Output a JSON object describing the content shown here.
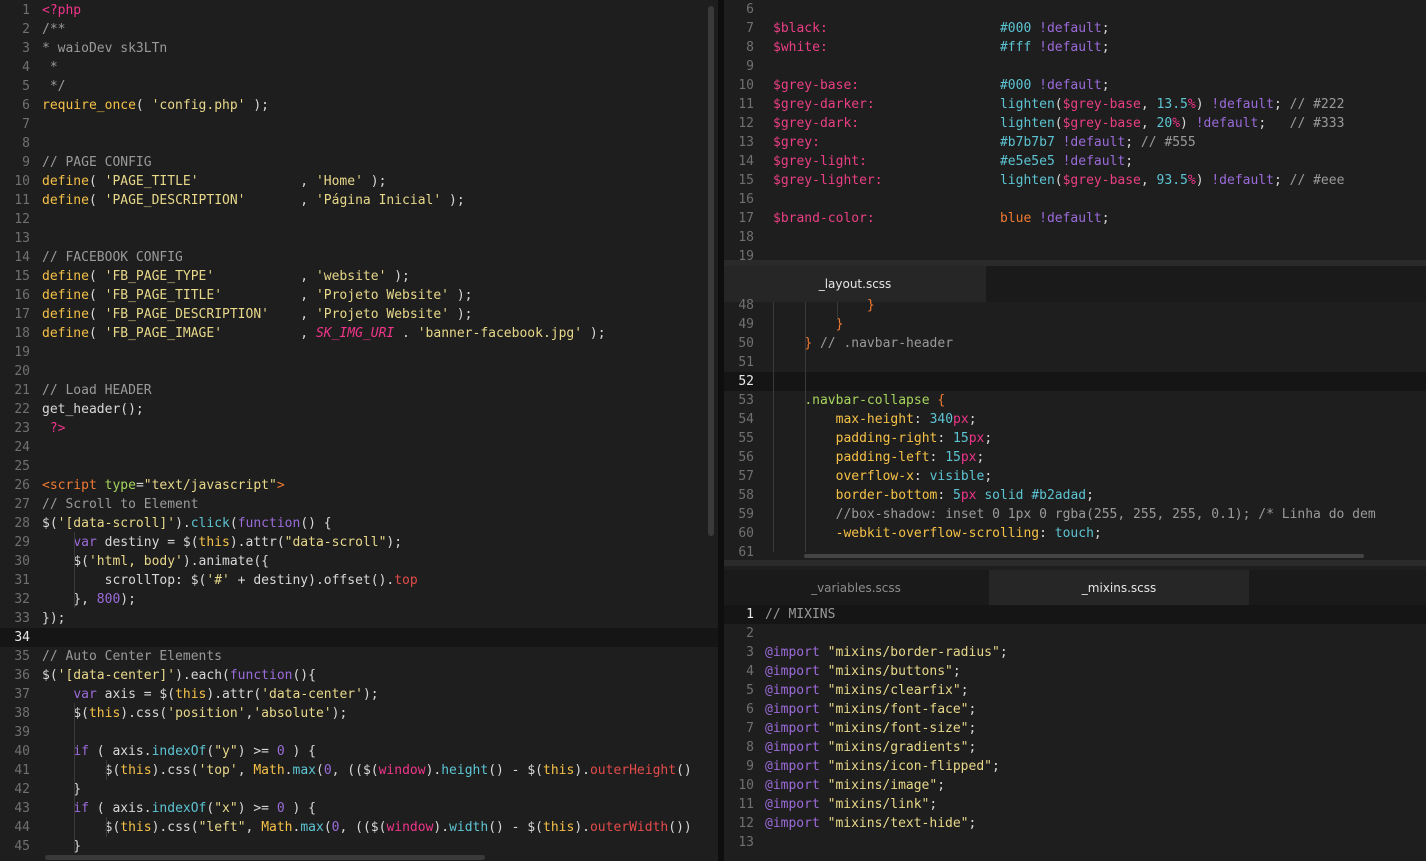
{
  "left_editor": {
    "lines": [
      {
        "n": "1",
        "html": "<span class='pink'>&lt;?php</span>"
      },
      {
        "n": "2",
        "html": "<span class='c'>/**</span>"
      },
      {
        "n": "3",
        "html": "<span class='c'>* waioDev sk3LTn</span>"
      },
      {
        "n": "4",
        "html": "<span class='c'> *</span>"
      },
      {
        "n": "5",
        "html": "<span class='c'> */</span>"
      },
      {
        "n": "6",
        "html": "<span class='y'>require_once</span>( <span class='s'>'config.php'</span> );"
      },
      {
        "n": "7",
        "html": ""
      },
      {
        "n": "8",
        "html": ""
      },
      {
        "n": "9",
        "html": "<span class='c'>// PAGE CONFIG</span>"
      },
      {
        "n": "10",
        "html": "<span class='y'>define</span>( <span class='s'>'PAGE_TITLE'</span>             , <span class='s'>'Home'</span> );"
      },
      {
        "n": "11",
        "html": "<span class='y'>define</span>( <span class='s'>'PAGE_DESCRIPTION'</span>       , <span class='s'>'Página Inicial'</span> );"
      },
      {
        "n": "12",
        "html": ""
      },
      {
        "n": "13",
        "html": ""
      },
      {
        "n": "14",
        "html": "<span class='c'>// FACEBOOK CONFIG</span>"
      },
      {
        "n": "15",
        "html": "<span class='y'>define</span>( <span class='s'>'FB_PAGE_TYPE'</span>           , <span class='s'>'website'</span> );"
      },
      {
        "n": "16",
        "html": "<span class='y'>define</span>( <span class='s'>'FB_PAGE_TITLE'</span>          , <span class='s'>'Projeto Website'</span> );"
      },
      {
        "n": "17",
        "html": "<span class='y'>define</span>( <span class='s'>'FB_PAGE_DESCRIPTION'</span>    , <span class='s'>'Projeto Website'</span> );"
      },
      {
        "n": "18",
        "html": "<span class='y'>define</span>( <span class='s'>'FB_PAGE_IMAGE'</span>          , <span class='pink'><i>SK_IMG_URI</i></span> . <span class='s'>'banner-facebook.jpg'</span> );"
      },
      {
        "n": "19",
        "html": ""
      },
      {
        "n": "20",
        "html": ""
      },
      {
        "n": "21",
        "html": "<span class='c'>// Load HEADER</span>"
      },
      {
        "n": "22",
        "html": "get_header();"
      },
      {
        "n": "23",
        "html": " <span class='pink'>?&gt;</span>"
      },
      {
        "n": "24",
        "html": ""
      },
      {
        "n": "25",
        "html": ""
      },
      {
        "n": "26",
        "html": "<span class='k'>&lt;script</span> <span class='grn'>type</span>=<span class='s'>\"text/javascript\"</span><span class='k'>&gt;</span>"
      },
      {
        "n": "27",
        "html": "<span class='c'>// Scroll to Element</span>"
      },
      {
        "n": "28",
        "html": "$(<span class='s'>'[data-scroll]'</span>).<span class='cy'>click</span>(<span class='pur'>function</span>() {"
      },
      {
        "n": "29",
        "html": "    <span class='pur'>var</span> destiny = $(<span class='y'>this</span>).attr(<span class='s'>\"data-scroll\"</span>);"
      },
      {
        "n": "30",
        "html": "    $(<span class='s'>'html, body'</span>).animate({"
      },
      {
        "n": "31",
        "html": "        scrollTop: $(<span class='s'>'#'</span> + destiny).offset().<span class='red'>top</span>"
      },
      {
        "n": "32",
        "html": "    }, <span class='pur'>800</span>);"
      },
      {
        "n": "33",
        "html": "});"
      },
      {
        "n": "34",
        "html": "",
        "hl": true
      },
      {
        "n": "35",
        "html": "<span class='c'>// Auto Center Elements</span>"
      },
      {
        "n": "36",
        "html": "$(<span class='s'>'[data-center]'</span>).each(<span class='pur'>function</span>(){"
      },
      {
        "n": "37",
        "html": "    <span class='pur'>var</span> axis = $(<span class='y'>this</span>).attr(<span class='s'>'data-center'</span>);"
      },
      {
        "n": "38",
        "html": "    $(<span class='y'>this</span>).css(<span class='s'>'position'</span>,<span class='s'>'absolute'</span>);"
      },
      {
        "n": "39",
        "html": ""
      },
      {
        "n": "40",
        "html": "    <span class='pur'>if</span> ( axis.<span class='cy'>indexOf</span>(<span class='s'>\"y\"</span>) &gt;= <span class='pur'>0</span> ) {"
      },
      {
        "n": "41",
        "html": "        $(<span class='y'>this</span>).css(<span class='s'>'top'</span>, <span class='y'>Math</span>.<span class='cy'>max</span>(<span class='pur'>0</span>, (($(<span class='pink'>window</span>).<span class='cy'>height</span>() - $(<span class='y'>this</span>).<span class='red'>outerHeight</span>()"
      },
      {
        "n": "42",
        "html": "    }"
      },
      {
        "n": "43",
        "html": "    <span class='pur'>if</span> ( axis.<span class='cy'>indexOf</span>(<span class='s'>\"x\"</span>) &gt;= <span class='pur'>0</span> ) {"
      },
      {
        "n": "44",
        "html": "        $(<span class='y'>this</span>).css(<span class='s'>\"left\"</span>, <span class='y'>Math</span>.<span class='cy'>max</span>(<span class='pur'>0</span>, (($(<span class='pink'>window</span>).<span class='cy'>width</span>() - $(<span class='y'>this</span>).<span class='red'>outerWidth</span>())"
      },
      {
        "n": "45",
        "html": "    }"
      }
    ]
  },
  "top_right_editor": {
    "lines": [
      {
        "n": "6",
        "html": ""
      },
      {
        "n": "7",
        "html": "<span class='var'>$black:</span>                      <span class='cy'>#000</span> <span class='pur'>!default</span>;"
      },
      {
        "n": "8",
        "html": "<span class='var'>$white:</span>                      <span class='cy'>#fff</span> <span class='pur'>!default</span>;"
      },
      {
        "n": "9",
        "html": ""
      },
      {
        "n": "10",
        "html": "<span class='var'>$grey-base:</span>                  <span class='cy'>#000</span> <span class='pur'>!default</span>;"
      },
      {
        "n": "11",
        "html": "<span class='var'>$grey-darker:</span>                <span class='cy'>lighten</span>(<span class='var'>$grey-base</span>, <span class='cy'>13.5</span><span class='pink'>%</span>) <span class='pur'>!default</span>; <span class='c'>// #222</span>"
      },
      {
        "n": "12",
        "html": "<span class='var'>$grey-dark:</span>                  <span class='cy'>lighten</span>(<span class='var'>$grey-base</span>, <span class='cy'>20</span><span class='pink'>%</span>) <span class='pur'>!default</span>;   <span class='c'>// #333</span>"
      },
      {
        "n": "13",
        "html": "<span class='var'>$grey:</span>                       <span class='cy'>#b7b7b7</span> <span class='pur'>!default</span>; <span class='c'>// #555</span>"
      },
      {
        "n": "14",
        "html": "<span class='var'>$grey-light:</span>                 <span class='cy'>#e5e5e5</span> <span class='pur'>!default</span>;"
      },
      {
        "n": "15",
        "html": "<span class='var'>$grey-lighter:</span>               <span class='cy'>lighten</span>(<span class='var'>$grey-base</span>, <span class='cy'>93.5</span><span class='pink'>%</span>) <span class='pur'>!default</span>; <span class='c'>// #eee</span>"
      },
      {
        "n": "16",
        "html": ""
      },
      {
        "n": "17",
        "html": "<span class='var'>$brand-color:</span>                <span class='k'>blue</span> <span class='pur'>!default</span>;"
      },
      {
        "n": "18",
        "html": ""
      },
      {
        "n": "19",
        "html": ""
      }
    ]
  },
  "middle_right_editor": {
    "tab": "_layout.scss",
    "lines": [
      {
        "n": "48",
        "html": "            <span class='k'>}</span>"
      },
      {
        "n": "49",
        "html": "        <span class='k'>}</span>"
      },
      {
        "n": "50",
        "html": "    <span class='k'>}</span> <span class='c'>// .navbar-header</span>"
      },
      {
        "n": "51",
        "html": ""
      },
      {
        "n": "52",
        "html": "",
        "hl": true
      },
      {
        "n": "53",
        "html": "    <span class='grn'>.navbar-collapse</span> <span class='k'>{</span>"
      },
      {
        "n": "54",
        "html": "        <span class='y'>max-height</span>: <span class='cy'>340</span><span class='pink'>px</span>;"
      },
      {
        "n": "55",
        "html": "        <span class='y'>padding-right</span>: <span class='cy'>15</span><span class='pink'>px</span>;"
      },
      {
        "n": "56",
        "html": "        <span class='y'>padding-left</span>: <span class='cy'>15</span><span class='pink'>px</span>;"
      },
      {
        "n": "57",
        "html": "        <span class='y'>overflow-x</span>: <span class='cy'>visible</span>;"
      },
      {
        "n": "58",
        "html": "        <span class='y'>border-bottom</span>: <span class='cy'>5</span><span class='pink'>px</span> <span class='cy'>solid</span> <span class='cy'>#b2adad</span>;"
      },
      {
        "n": "59",
        "html": "        <span class='c'>//box-shadow: inset 0 1px 0 rgba(255, 255, 255, 0.1); /* Linha do dem</span>"
      },
      {
        "n": "60",
        "html": "        <span class='y'>-webkit-overflow-scrolling</span>: <span class='cy'>touch</span>;"
      },
      {
        "n": "61",
        "html": ""
      }
    ]
  },
  "bottom_right_editor": {
    "tabs": [
      "_variables.scss",
      "_mixins.scss"
    ],
    "lines": [
      {
        "n": "1",
        "html": "<span class='c'>// MIXINS</span>",
        "hl": true
      },
      {
        "n": "2",
        "html": ""
      },
      {
        "n": "3",
        "html": "<span class='pur'>@import</span> <span class='s'>\"mixins/border-radius\"</span>;"
      },
      {
        "n": "4",
        "html": "<span class='pur'>@import</span> <span class='s'>\"mixins/buttons\"</span>;"
      },
      {
        "n": "5",
        "html": "<span class='pur'>@import</span> <span class='s'>\"mixins/clearfix\"</span>;"
      },
      {
        "n": "6",
        "html": "<span class='pur'>@import</span> <span class='s'>\"mixins/font-face\"</span>;"
      },
      {
        "n": "7",
        "html": "<span class='pur'>@import</span> <span class='s'>\"mixins/font-size\"</span>;"
      },
      {
        "n": "8",
        "html": "<span class='pur'>@import</span> <span class='s'>\"mixins/gradients\"</span>;"
      },
      {
        "n": "9",
        "html": "<span class='pur'>@import</span> <span class='s'>\"mixins/icon-flipped\"</span>;"
      },
      {
        "n": "10",
        "html": "<span class='pur'>@import</span> <span class='s'>\"mixins/image\"</span>;"
      },
      {
        "n": "11",
        "html": "<span class='pur'>@import</span> <span class='s'>\"mixins/link\"</span>;"
      },
      {
        "n": "12",
        "html": "<span class='pur'>@import</span> <span class='s'>\"mixins/text-hide\"</span>;"
      },
      {
        "n": "13",
        "html": ""
      }
    ]
  }
}
